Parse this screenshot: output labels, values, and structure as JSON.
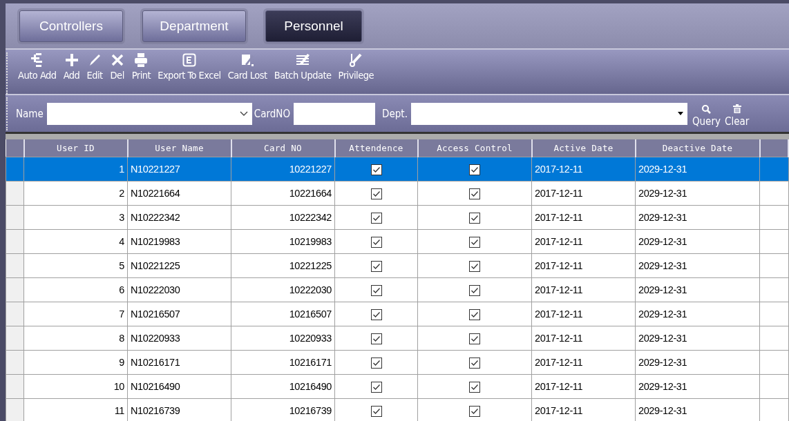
{
  "tabs": [
    {
      "label": "Controllers",
      "selected": false
    },
    {
      "label": "Department",
      "selected": false
    },
    {
      "label": "Personnel",
      "selected": true
    }
  ],
  "toolbar": [
    {
      "label": "Auto Add",
      "kind": "autoadd"
    },
    {
      "label": "Add",
      "kind": "add"
    },
    {
      "label": "Edit",
      "kind": "edit"
    },
    {
      "label": "Del",
      "kind": "del"
    },
    {
      "label": "Print",
      "kind": "print"
    },
    {
      "label": "Export To Excel",
      "kind": "excel"
    },
    {
      "label": "Card Lost",
      "kind": "cardlost"
    },
    {
      "label": "Batch Update",
      "kind": "batch"
    },
    {
      "label": "Privilege",
      "kind": "privilege"
    }
  ],
  "filter": {
    "name_label": "Name",
    "card_label": "CardNO",
    "dept_label": "Dept.",
    "buttons": [
      {
        "label": "Query",
        "kind": "query"
      },
      {
        "label": "Clear",
        "kind": "clear"
      }
    ]
  },
  "table": {
    "columns": [
      "User ID",
      "User Name",
      "Card NO",
      "Attendence",
      "Access Control",
      "Active Date",
      "Deactive Date"
    ],
    "rows": [
      {
        "selected": true,
        "user_id": "1",
        "user_name": "N10221227",
        "card_no": "10221227",
        "attendance": true,
        "access_control": true,
        "active_date": "2017-12-11",
        "deactive_date": "2029-12-31"
      },
      {
        "selected": false,
        "user_id": "2",
        "user_name": "N10221664",
        "card_no": "10221664",
        "attendance": true,
        "access_control": true,
        "active_date": "2017-12-11",
        "deactive_date": "2029-12-31"
      },
      {
        "selected": false,
        "user_id": "3",
        "user_name": "N10222342",
        "card_no": "10222342",
        "attendance": true,
        "access_control": true,
        "active_date": "2017-12-11",
        "deactive_date": "2029-12-31"
      },
      {
        "selected": false,
        "user_id": "4",
        "user_name": "N10219983",
        "card_no": "10219983",
        "attendance": true,
        "access_control": true,
        "active_date": "2017-12-11",
        "deactive_date": "2029-12-31"
      },
      {
        "selected": false,
        "user_id": "5",
        "user_name": "N10221225",
        "card_no": "10221225",
        "attendance": true,
        "access_control": true,
        "active_date": "2017-12-11",
        "deactive_date": "2029-12-31"
      },
      {
        "selected": false,
        "user_id": "6",
        "user_name": "N10222030",
        "card_no": "10222030",
        "attendance": true,
        "access_control": true,
        "active_date": "2017-12-11",
        "deactive_date": "2029-12-31"
      },
      {
        "selected": false,
        "user_id": "7",
        "user_name": "N10216507",
        "card_no": "10216507",
        "attendance": true,
        "access_control": true,
        "active_date": "2017-12-11",
        "deactive_date": "2029-12-31"
      },
      {
        "selected": false,
        "user_id": "8",
        "user_name": "N10220933",
        "card_no": "10220933",
        "attendance": true,
        "access_control": true,
        "active_date": "2017-12-11",
        "deactive_date": "2029-12-31"
      },
      {
        "selected": false,
        "user_id": "9",
        "user_name": "N10216171",
        "card_no": "10216171",
        "attendance": true,
        "access_control": true,
        "active_date": "2017-12-11",
        "deactive_date": "2029-12-31"
      },
      {
        "selected": false,
        "user_id": "10",
        "user_name": "N10216490",
        "card_no": "10216490",
        "attendance": true,
        "access_control": true,
        "active_date": "2017-12-11",
        "deactive_date": "2029-12-31"
      },
      {
        "selected": false,
        "user_id": "11",
        "user_name": "N10216739",
        "card_no": "10216739",
        "attendance": true,
        "access_control": true,
        "active_date": "2017-12-11",
        "deactive_date": "2029-12-31"
      }
    ]
  }
}
